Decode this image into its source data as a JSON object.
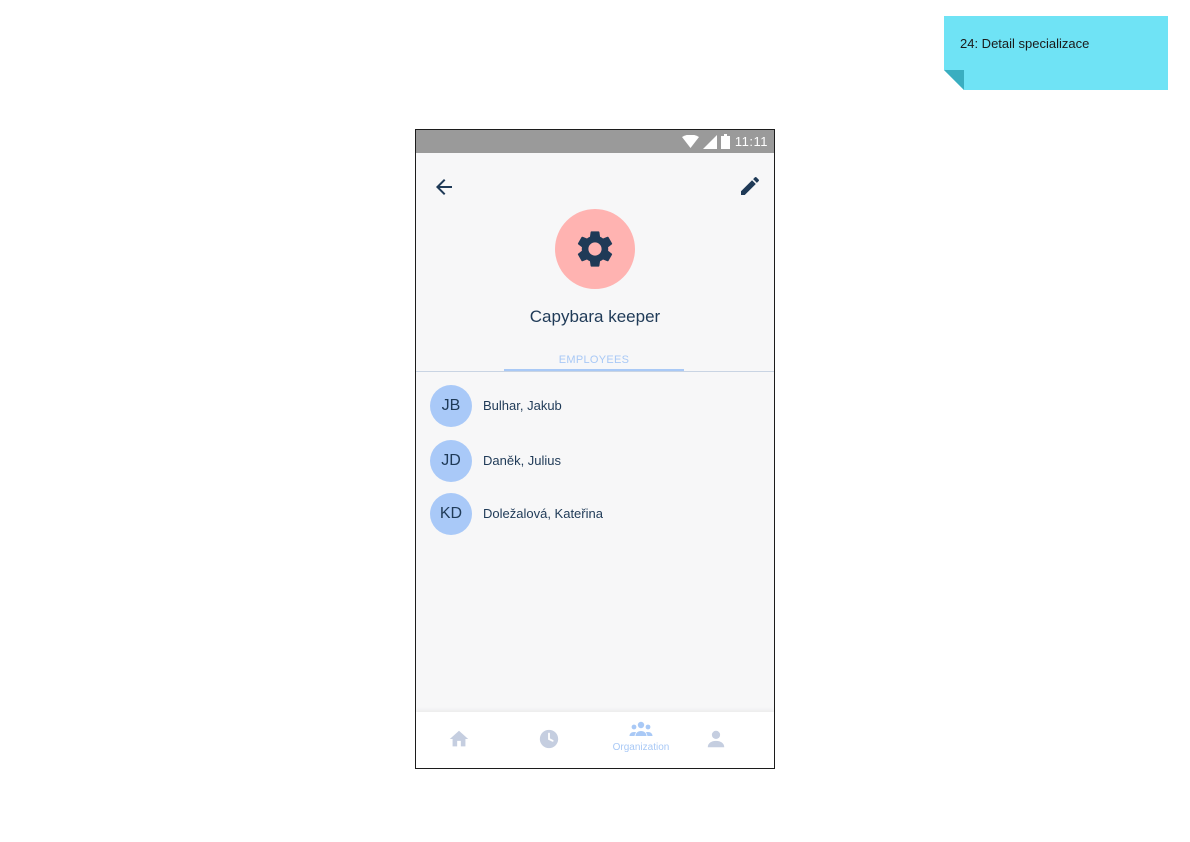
{
  "sticky_note": {
    "text": "24: Detail specializace",
    "color": "#6fe3f5"
  },
  "status_bar": {
    "time": "11:11"
  },
  "header": {
    "back_icon": "arrow-left-icon",
    "edit_icon": "pencil-icon"
  },
  "specialization": {
    "title": "Capybara keeper",
    "icon": "gear-icon",
    "avatar_color": "#ffb3b1"
  },
  "tabs": [
    {
      "label": "EMPLOYEES",
      "active": true
    }
  ],
  "employees": [
    {
      "initials": "JB",
      "name": "Bulhar, Jakub"
    },
    {
      "initials": "JD",
      "name": "Daněk, Julius"
    },
    {
      "initials": "KD",
      "name": "Doležalová, Kateřina"
    }
  ],
  "bottom_nav": {
    "items": [
      {
        "icon": "home-icon",
        "label": "",
        "active": false
      },
      {
        "icon": "clock-icon",
        "label": "",
        "active": false
      },
      {
        "icon": "people-icon",
        "label": "Organization",
        "active": true
      },
      {
        "icon": "person-icon",
        "label": "",
        "active": false
      }
    ]
  },
  "colors": {
    "accent": "#a9c9f6",
    "text_dark": "#1f3a57",
    "inactive_icon": "#c5cee0"
  }
}
